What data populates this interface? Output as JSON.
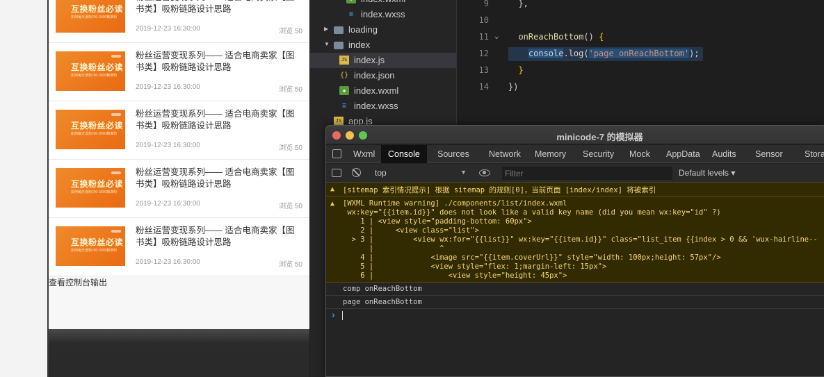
{
  "simulator": {
    "items": [
      {
        "title": "粉丝运营变现系列—— 适合电商卖家【图书类】吸粉链路设计思路",
        "date": "2019-12-23 16:30:00",
        "views": "浏览 50",
        "thumb_title": "互换粉丝必读",
        "thumb_sub": "如何每天涨粉200-3000精准粉"
      },
      {
        "title": "粉丝运营变现系列—— 适合电商卖家【图书类】吸粉链路设计思路",
        "date": "2019-12-23 16:30:00",
        "views": "浏览 50",
        "thumb_title": "互换粉丝必读",
        "thumb_sub": "如何每天涨粉200-3000精准粉"
      },
      {
        "title": "粉丝运营变现系列—— 适合电商卖家【图书类】吸粉链路设计思路",
        "date": "2019-12-23 16:30:00",
        "views": "浏览 50",
        "thumb_title": "互换粉丝必读",
        "thumb_sub": "如何每天涨粉200-3000精准粉"
      },
      {
        "title": "粉丝运营变现系列—— 适合电商卖家【图书类】吸粉链路设计思路",
        "date": "2019-12-23 16:30:00",
        "views": "浏览 50",
        "thumb_title": "互换粉丝必读",
        "thumb_sub": "如何每天涨粉200-3000精准粉"
      },
      {
        "title": "粉丝运营变现系列—— 适合电商卖家【图书类】吸粉链路设计思路",
        "date": "2019-12-23 16:30:00",
        "views": "浏览 50",
        "thumb_title": "互换粉丝必读",
        "thumb_sub": "如何每天涨粉200-3000精准粉"
      }
    ],
    "console_link": "查看控制台输出"
  },
  "file_tree": {
    "rows": [
      {
        "label": "index.wxml",
        "icon": "wxml-file-icon"
      },
      {
        "label": "index.wxss",
        "icon": "wxss-file-icon"
      },
      {
        "label": "loading",
        "icon": "folder-icon"
      },
      {
        "label": "index",
        "icon": "folder-open-icon"
      },
      {
        "label": "index.js",
        "icon": "js-file-icon"
      },
      {
        "label": "index.json",
        "icon": "json-file-icon"
      },
      {
        "label": "index.wxml",
        "icon": "wxml-file-icon"
      },
      {
        "label": "index.wxss",
        "icon": "wxss-file-icon"
      },
      {
        "label": "app.js",
        "icon": "js-file-icon"
      }
    ],
    "selected": "index.js"
  },
  "editor": {
    "lines": [
      {
        "num": "9",
        "code": "  },"
      },
      {
        "num": "10",
        "code": ""
      },
      {
        "num": "11",
        "code": "  onReachBottom() {"
      },
      {
        "num": "12",
        "code": "    console.log('page onReachBottom');"
      },
      {
        "num": "13",
        "code": "  }"
      },
      {
        "num": "14",
        "code": "})"
      }
    ]
  },
  "devtools": {
    "window_title": "minicode-7 的模拟器",
    "tabs": [
      "Wxml",
      "Console",
      "Sources",
      "Network",
      "Memory",
      "Security",
      "Mock",
      "AppData",
      "Audits",
      "Sensor",
      "Stora"
    ],
    "active_tab": "Console",
    "context": "top",
    "filter_placeholder": "Filter",
    "levels": "Default levels ▾",
    "warning1": "[sitemap 索引情况提示] 根据 sitemap 的规则[0]，当前页面 [index/index] 将被索引",
    "warning2": {
      "head": "[WXML Runtime warning] ./components/list/index.wxml",
      "detail": " wx:key=\"{{item.id}}\" does not look like a valid key name (did you mean wx:key=\"id\" ?)",
      "lines": [
        "    1 | <view style=\"padding-bottom: 60px\">",
        "    2 |     <view class=\"list\">",
        "  > 3 |         <view wx:for=\"{{list}}\" wx:key=\"{{item.id}}\" class=\"list_item {{index > 0 && 'wux-hairline--",
        "      |               ^",
        "    4 |             <image src=\"{{item.coverUrl}}\" style=\"width: 100px;height: 57px\"/>",
        "    5 |             <view style=\"flex: 1;margin-left: 15px\">",
        "    6 |                 <view style=\"height: 45px\">"
      ]
    },
    "log1": "comp onReachBottom",
    "log2": "page onReachBottom",
    "prompt": "›"
  }
}
